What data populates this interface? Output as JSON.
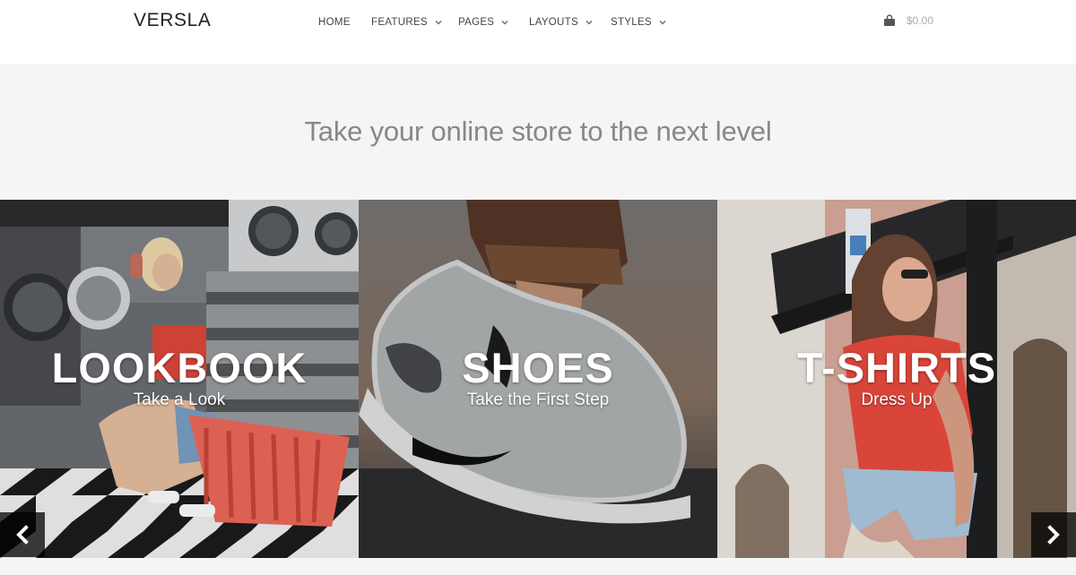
{
  "brand": "VERSLA",
  "nav": {
    "items": [
      {
        "label": "HOME",
        "dropdown": false
      },
      {
        "label": "FEATURES",
        "dropdown": true
      },
      {
        "label": "PAGES",
        "dropdown": true
      },
      {
        "label": "LAYOUTS",
        "dropdown": true
      },
      {
        "label": "STYLES",
        "dropdown": true
      }
    ]
  },
  "cart": {
    "icon": "shopping-bag-icon",
    "total": "$0.00"
  },
  "hero": {
    "tagline": "Take your online store to the next level"
  },
  "slides": [
    {
      "title": "LOOKBOOK",
      "subtitle": "Take a Look"
    },
    {
      "title": "SHOES",
      "subtitle": "Take the First Step"
    },
    {
      "title": "T-SHIRTS",
      "subtitle": "Dress Up"
    }
  ],
  "controls": {
    "prev_icon": "chevron-left-icon",
    "next_icon": "chevron-right-icon"
  },
  "colors": {
    "accent_red": "#e8473a",
    "header_bg": "#ffffff",
    "hero_bg": "#f5f5f5"
  }
}
